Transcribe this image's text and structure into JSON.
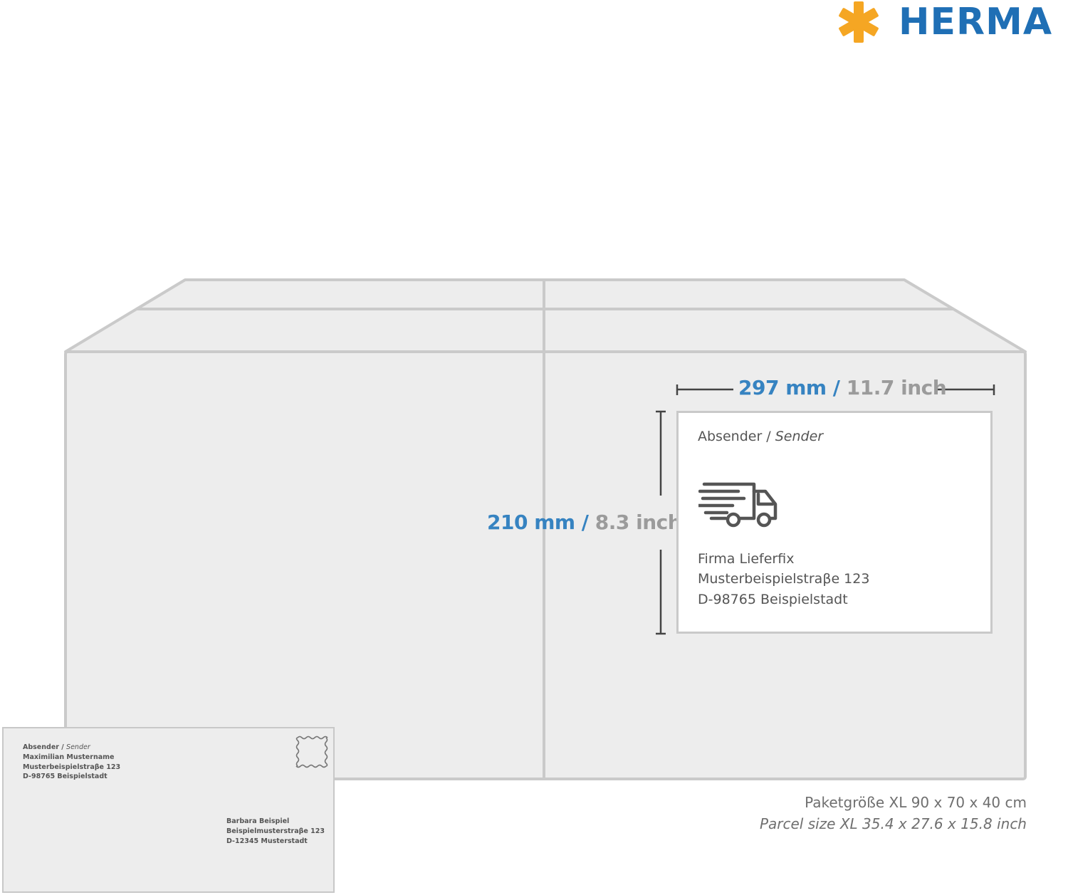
{
  "brand": {
    "name": "HERMA",
    "asterisk_color": "#f5a623",
    "text_color": "#1f6fb5"
  },
  "colors": {
    "mm": "#3683c1",
    "inch": "#9b9b9b",
    "box_fill": "#ededed",
    "box_stroke": "#cacaca"
  },
  "dimensions": {
    "width": {
      "mm": "297 mm",
      "separator": "/",
      "inch": "11.7 inch"
    },
    "height": {
      "mm": "210 mm",
      "separator": "/",
      "inch": "8.3 inch"
    }
  },
  "label": {
    "sender_caption_de": "Absender /",
    "sender_caption_en": "Sender",
    "icon": "delivery-truck-icon",
    "address": [
      "Firma Lieferfix",
      "Musterbeispielstraβe 123",
      "D-98765 Beispielstadt"
    ]
  },
  "envelope": {
    "sender_caption_de": "Absender /",
    "sender_caption_en": "Sender",
    "sender_address": [
      "Maximilian Mustername",
      "Musterbeispielstraβe 123",
      "D-98765 Beispielstadt"
    ],
    "recipient_address": [
      "Barbara Beispiel",
      "Beispielmusterstraβe 123",
      "D-12345 Musterstadt"
    ],
    "icon": "postage-stamp-icon"
  },
  "parcel_size": {
    "de": "Paketgröße XL 90 x 70 x 40 cm",
    "en": "Parcel size XL 35.4 x 27.6 x 15.8 inch"
  }
}
